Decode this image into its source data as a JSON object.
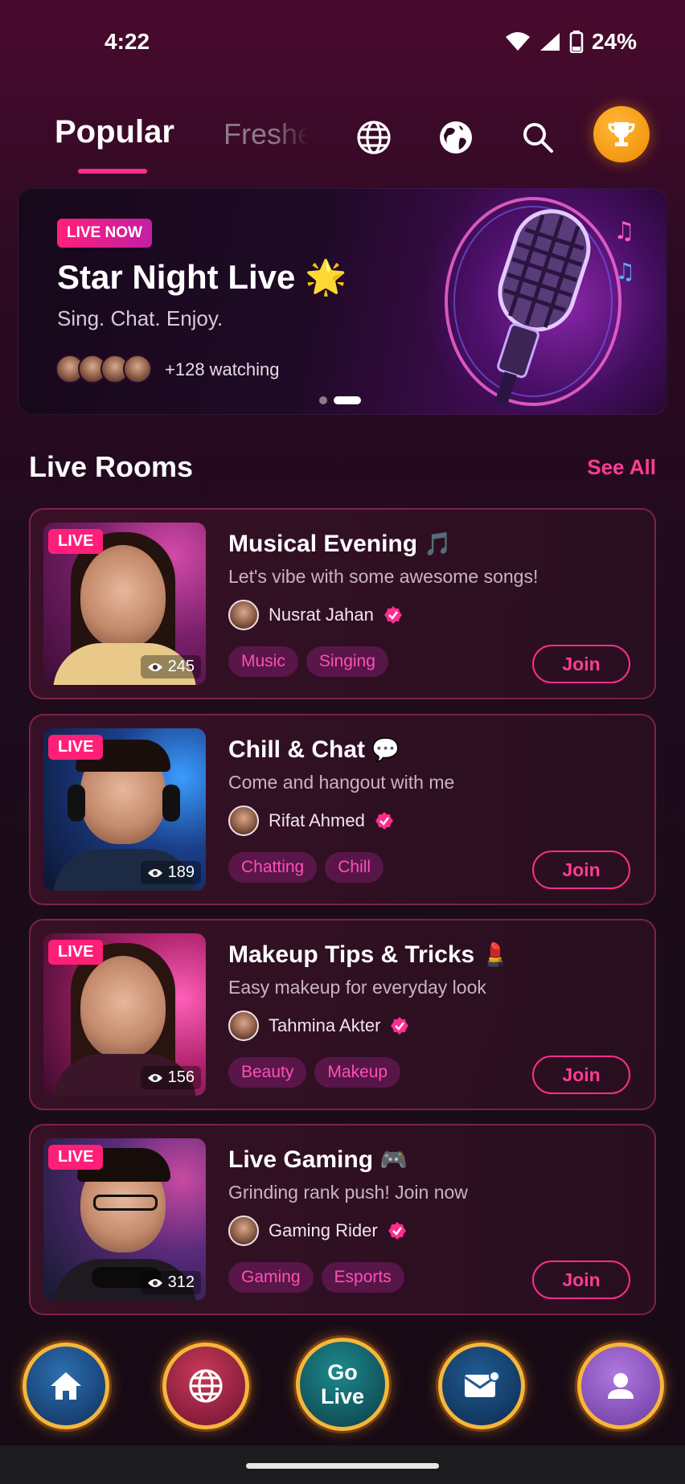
{
  "status_bar": {
    "time": "4:22",
    "battery": "24%"
  },
  "top_nav": {
    "tabs": [
      {
        "label": "Popular",
        "active": true
      },
      {
        "label": "Freshers",
        "active": false
      }
    ],
    "icons": [
      "globe-icon",
      "world-icon",
      "search-icon",
      "trophy-icon"
    ]
  },
  "banner": {
    "badge": "LIVE NOW",
    "title": "Star Night Live",
    "title_emoji": "🌟",
    "subtitle": "Sing. Chat. Enjoy.",
    "watching": "+128 watching",
    "page_count": 2,
    "active_page": 2
  },
  "section": {
    "title": "Live Rooms",
    "see_all": "See All"
  },
  "rooms": [
    {
      "badge": "LIVE",
      "viewers": "245",
      "title": "Musical Evening",
      "emoji": "🎵",
      "description": "Let's vibe with some awesome songs!",
      "host": "Nusrat Jahan",
      "tags": [
        "Music",
        "Singing"
      ],
      "join": "Join"
    },
    {
      "badge": "LIVE",
      "viewers": "189",
      "title": "Chill & Chat",
      "emoji": "💬",
      "description": "Come and hangout with me",
      "host": "Rifat Ahmed",
      "tags": [
        "Chatting",
        "Chill"
      ],
      "join": "Join"
    },
    {
      "badge": "LIVE",
      "viewers": "156",
      "title": "Makeup Tips & Tricks",
      "emoji": "💄",
      "description": "Easy makeup for everyday look",
      "host": "Tahmina Akter",
      "tags": [
        "Beauty",
        "Makeup"
      ],
      "join": "Join"
    },
    {
      "badge": "LIVE",
      "viewers": "312",
      "title": "Live Gaming",
      "emoji": "🎮",
      "description": "Grinding rank push! Join now",
      "host": "Gaming Rider",
      "tags": [
        "Gaming",
        "Esports"
      ],
      "join": "Join"
    }
  ],
  "bottom_nav": {
    "go_live_line1": "Go",
    "go_live_line2": "Live",
    "items": [
      "home-icon",
      "globe-icon",
      "go-live",
      "mail-icon",
      "profile-icon"
    ]
  },
  "colors": {
    "accent": "#ff2d8e",
    "trophy": "#f39a10",
    "gold_ring": "#f4b73a"
  }
}
